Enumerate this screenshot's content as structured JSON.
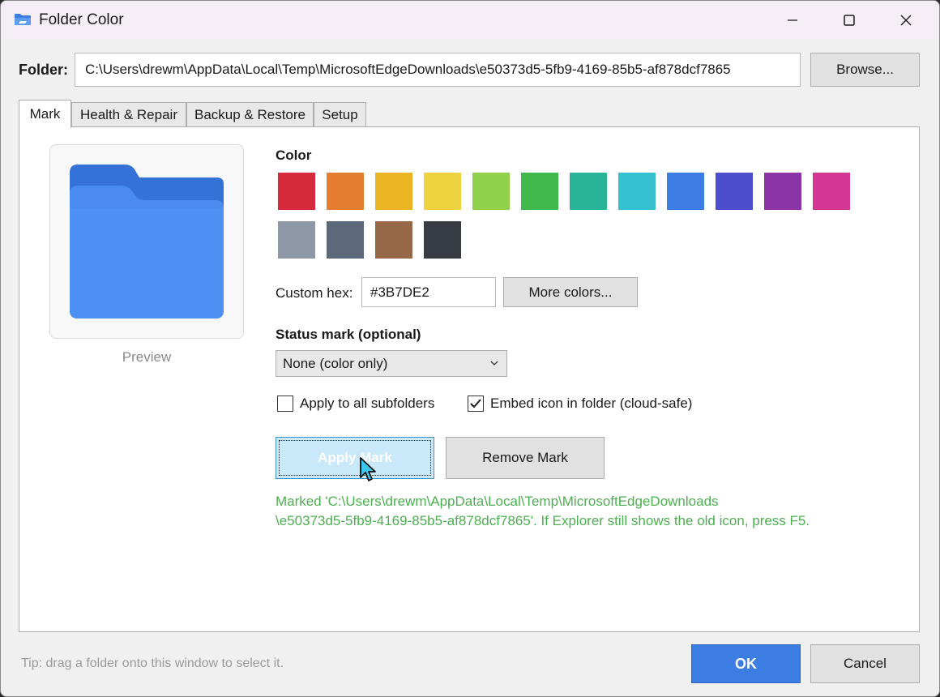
{
  "window": {
    "title": "Folder Color"
  },
  "folder": {
    "label": "Folder:",
    "path": "C:\\Users\\drewm\\AppData\\Local\\Temp\\MicrosoftEdgeDownloads\\e50373d5-5fb9-4169-85b5-af878dcf7865",
    "browse_label": "Browse..."
  },
  "tabs": [
    {
      "label": "Mark",
      "active": true
    },
    {
      "label": "Health & Repair",
      "active": false
    },
    {
      "label": "Backup & Restore",
      "active": false
    },
    {
      "label": "Setup",
      "active": false
    }
  ],
  "preview": {
    "label": "Preview",
    "folder_color": "#3B7DE2"
  },
  "color": {
    "label": "Color",
    "swatches_row1": [
      "#d42a3b",
      "#e67e32",
      "#ebb423",
      "#eed23f",
      "#8fd14b",
      "#40b84c",
      "#29b49a",
      "#35c0d0",
      "#3b7de2",
      "#4b4fcb",
      "#8a34a8",
      "#d53595"
    ],
    "swatches_row2": [
      "#8e97a6",
      "#5b697b",
      "#966848",
      "#373b42"
    ]
  },
  "custom_hex": {
    "label": "Custom hex:",
    "value": "#3B7DE2",
    "more_colors_label": "More colors..."
  },
  "status_mark": {
    "label": "Status mark (optional)",
    "selected": "None (color only)"
  },
  "options": {
    "apply_subfolders_label": "Apply to all subfolders",
    "apply_subfolders_checked": false,
    "embed_icon_label": "Embed icon in folder (cloud-safe)",
    "embed_icon_checked": true
  },
  "actions": {
    "apply_label": "Apply Mark",
    "remove_label": "Remove Mark"
  },
  "status_message": {
    "line1": "Marked 'C:\\Users\\drewm\\AppData\\Local\\Temp\\MicrosoftEdgeDownloads",
    "line2": "\\e50373d5-5fb9-4169-85b5-af878dcf7865'. If Explorer still shows the old icon, press F5.",
    "color": "#4caf50"
  },
  "footer": {
    "tip": "Tip: drag a folder onto this window to select it.",
    "ok_label": "OK",
    "cancel_label": "Cancel"
  },
  "accent_color": "#3B7DE2"
}
